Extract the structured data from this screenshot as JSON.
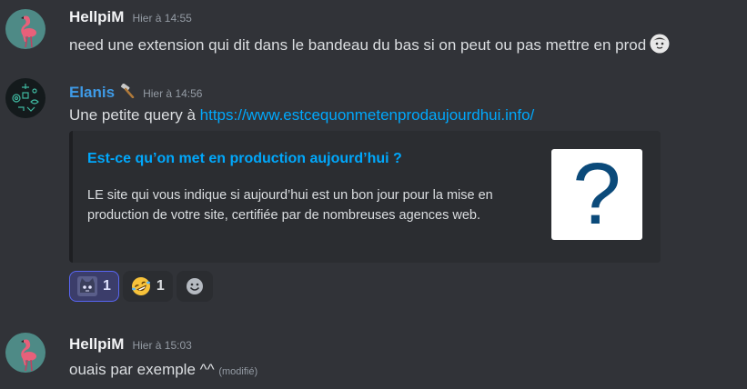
{
  "messages": [
    {
      "author": "HellpiM",
      "timestamp": "Hier à 14:55",
      "avatar": "flamingo-avatar",
      "text": "need une extension qui dit dans le bandeau du bas si on peut ou pas mettre en prod"
    },
    {
      "author": "Elanis",
      "author_color": "#3e9ae6",
      "badge": "hammer-icon",
      "timestamp": "Hier à 14:56",
      "avatar": "circuit-avatar",
      "text_prefix": "Une petite query à ",
      "link": "https://www.estcequonmetenprodaujourdhui.info/",
      "embed": {
        "title": "Est-ce qu’on met en production aujourd’hui ?",
        "description": "LE site qui vous indique si aujourd’hui est un bon jour pour la mise en production de votre site, certifiée par de nombreuses agences web.",
        "thumbnail_glyph": "?"
      },
      "reactions": [
        {
          "emoji": "cat-face-emoji",
          "count": "1",
          "active": true
        },
        {
          "emoji": "rofl-emoji",
          "count": "1",
          "active": false
        }
      ],
      "add_reaction": "add-reaction-icon"
    },
    {
      "author": "HellpiM",
      "timestamp": "Hier à 15:03",
      "avatar": "flamingo-avatar",
      "text": "ouais par exemple ^^",
      "edited": "(modifié)"
    }
  ],
  "colors": {
    "background": "#313338",
    "link": "#00a8fc",
    "embed_bg": "#2b2d31",
    "reaction_active": "#5865f2"
  }
}
